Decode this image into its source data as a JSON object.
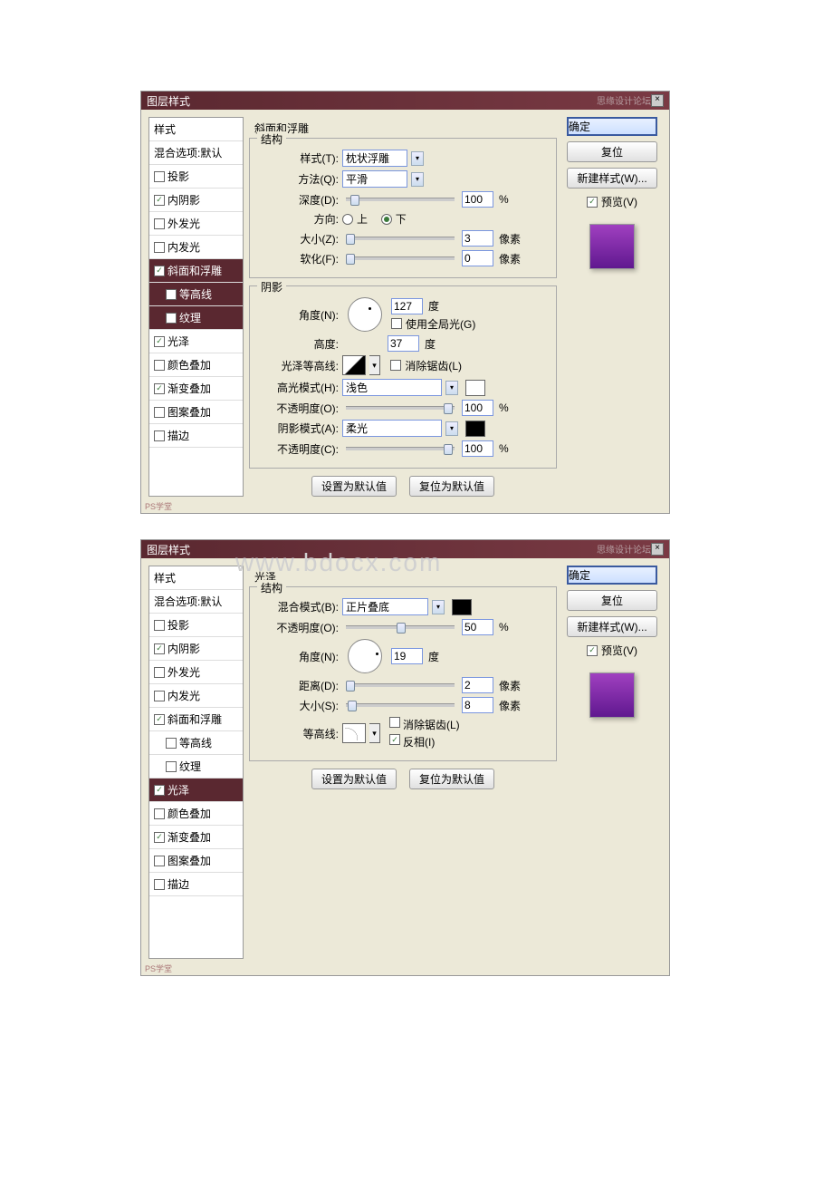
{
  "dialog1": {
    "title": "图层样式",
    "watermark_tr": "思缘设计论坛",
    "watermark_bl": "PS学堂",
    "sidebar": {
      "styles": "样式",
      "blend": "混合选项:默认",
      "drop_shadow": "投影",
      "inner_shadow": "内阴影",
      "outer_glow": "外发光",
      "inner_glow": "内发光",
      "bevel": "斜面和浮雕",
      "contour": "等高线",
      "texture": "纹理",
      "satin": "光泽",
      "color_overlay": "颜色叠加",
      "gradient_overlay": "渐变叠加",
      "pattern_overlay": "图案叠加",
      "stroke": "描边"
    },
    "panel_title": "斜面和浮雕",
    "structure": {
      "legend": "结构",
      "style_label": "样式(T):",
      "style_value": "枕状浮雕",
      "method_label": "方法(Q):",
      "method_value": "平滑",
      "depth_label": "深度(D):",
      "depth_value": "100",
      "depth_unit": "%",
      "direction_label": "方向:",
      "up": "上",
      "down": "下",
      "size_label": "大小(Z):",
      "size_value": "3",
      "size_unit": "像素",
      "soften_label": "软化(F):",
      "soften_value": "0",
      "soften_unit": "像素"
    },
    "shading": {
      "legend": "阴影",
      "angle_label": "角度(N):",
      "angle_value": "127",
      "angle_unit": "度",
      "global_light": "使用全局光(G)",
      "altitude_label": "高度:",
      "altitude_value": "37",
      "altitude_unit": "度",
      "gloss_contour_label": "光泽等高线:",
      "antialias": "消除锯齿(L)",
      "highlight_mode_label": "高光模式(H):",
      "highlight_mode_value": "浅色",
      "highlight_opacity_label": "不透明度(O):",
      "highlight_opacity_value": "100",
      "highlight_opacity_unit": "%",
      "shadow_mode_label": "阴影模式(A):",
      "shadow_mode_value": "柔光",
      "shadow_opacity_label": "不透明度(C):",
      "shadow_opacity_value": "100",
      "shadow_opacity_unit": "%"
    },
    "make_default": "设置为默认值",
    "reset_default": "复位为默认值",
    "right": {
      "ok": "确定",
      "cancel": "复位",
      "new_style": "新建样式(W)...",
      "preview": "预览(V)",
      "preview_color": "#8a2aa8"
    }
  },
  "dialog2": {
    "title": "图层样式",
    "watermark_tr": "思缘设计论坛",
    "watermark_bl": "PS学堂",
    "sidebar": {
      "styles": "样式",
      "blend": "混合选项:默认",
      "drop_shadow": "投影",
      "inner_shadow": "内阴影",
      "outer_glow": "外发光",
      "inner_glow": "内发光",
      "bevel": "斜面和浮雕",
      "contour": "等高线",
      "texture": "纹理",
      "satin": "光泽",
      "color_overlay": "颜色叠加",
      "gradient_overlay": "渐变叠加",
      "pattern_overlay": "图案叠加",
      "stroke": "描边"
    },
    "panel_title": "光泽",
    "structure": {
      "legend": "结构",
      "blend_mode_label": "混合模式(B):",
      "blend_mode_value": "正片叠底",
      "blend_color": "#000000",
      "opacity_label": "不透明度(O):",
      "opacity_value": "50",
      "opacity_unit": "%",
      "angle_label": "角度(N):",
      "angle_value": "19",
      "angle_unit": "度",
      "distance_label": "距离(D):",
      "distance_value": "2",
      "distance_unit": "像素",
      "size_label": "大小(S):",
      "size_value": "8",
      "size_unit": "像素",
      "contour_label": "等高线:",
      "antialias": "消除锯齿(L)",
      "invert": "反相(I)"
    },
    "make_default": "设置为默认值",
    "reset_default": "复位为默认值",
    "right": {
      "ok": "确定",
      "cancel": "复位",
      "new_style": "新建样式(W)...",
      "preview": "预览(V)",
      "preview_color": "#8a2aa8"
    }
  },
  "page_watermark": "www.bdocx.com"
}
